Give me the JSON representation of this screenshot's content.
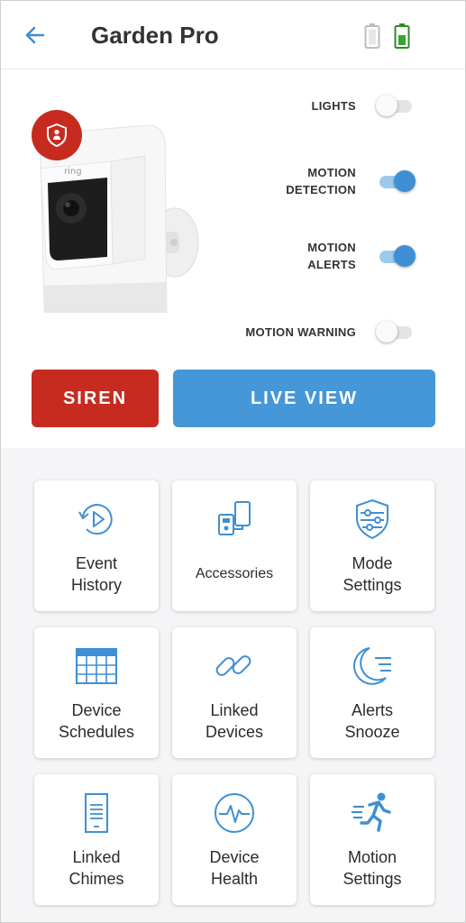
{
  "header": {
    "title": "Garden Pro",
    "back_icon": "back-arrow-icon",
    "batteries": [
      "battery-empty-icon",
      "battery-charging-icon"
    ]
  },
  "colors": {
    "accent_blue": "#4597d8",
    "siren_red": "#c72b1f",
    "toggle_on": "#3f8fd4",
    "battery_green": "#3aa335"
  },
  "toggles": [
    {
      "label_lines": [
        "LIGHTS"
      ],
      "on": false
    },
    {
      "label_lines": [
        "MOTION",
        "DETECTION"
      ],
      "on": true
    },
    {
      "label_lines": [
        "MOTION",
        "ALERTS"
      ],
      "on": true
    },
    {
      "label_lines": [
        "MOTION WARNING"
      ],
      "on": false
    }
  ],
  "actions": {
    "siren_label": "SIREN",
    "live_view_label": "LIVE VIEW"
  },
  "camera": {
    "brand": "ring"
  },
  "tiles": [
    {
      "lines": [
        "Event",
        "History"
      ],
      "icon": "history-play-icon"
    },
    {
      "lines": [
        "Accessories"
      ],
      "icon": "accessories-icon"
    },
    {
      "lines": [
        "Mode",
        "Settings"
      ],
      "icon": "shield-sliders-icon"
    },
    {
      "lines": [
        "Device",
        "Schedules"
      ],
      "icon": "calendar-icon"
    },
    {
      "lines": [
        "Linked",
        "Devices"
      ],
      "icon": "link-icon"
    },
    {
      "lines": [
        "Alerts",
        "Snooze"
      ],
      "icon": "moon-snooze-icon"
    },
    {
      "lines": [
        "Linked",
        "Chimes"
      ],
      "icon": "chime-icon"
    },
    {
      "lines": [
        "Device",
        "Health"
      ],
      "icon": "pulse-icon"
    },
    {
      "lines": [
        "Motion",
        "Settings"
      ],
      "icon": "running-person-icon"
    }
  ]
}
